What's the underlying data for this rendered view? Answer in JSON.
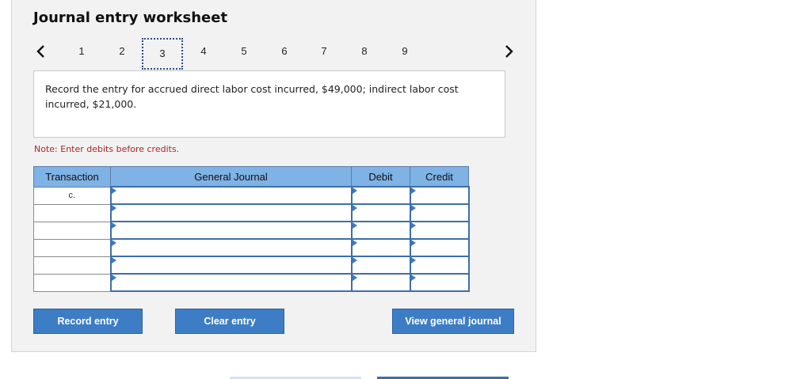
{
  "title": "Journal entry worksheet",
  "pagination": {
    "pages": [
      "1",
      "2",
      "3",
      "4",
      "5",
      "6",
      "7",
      "8",
      "9"
    ],
    "active": "3"
  },
  "prompt": "Record the entry for accrued direct labor cost incurred, $49,000; indirect labor cost incurred, $21,000.",
  "note": "Note: Enter debits before credits.",
  "table": {
    "headers": {
      "transaction": "Transaction",
      "journal": "General Journal",
      "debit": "Debit",
      "credit": "Credit"
    },
    "rows": [
      {
        "transaction": "c.",
        "account": "",
        "debit": "",
        "credit": ""
      },
      {
        "transaction": "",
        "account": "",
        "debit": "",
        "credit": ""
      },
      {
        "transaction": "",
        "account": "",
        "debit": "",
        "credit": ""
      },
      {
        "transaction": "",
        "account": "",
        "debit": "",
        "credit": ""
      },
      {
        "transaction": "",
        "account": "",
        "debit": "",
        "credit": ""
      },
      {
        "transaction": "",
        "account": "",
        "debit": "",
        "credit": ""
      }
    ]
  },
  "buttons": {
    "record": "Record entry",
    "clear": "Clear entry",
    "view": "View general journal"
  },
  "colors": {
    "accent": "#3d7dc6",
    "header_bg": "#7fb2e5",
    "note": "#a8272b"
  }
}
